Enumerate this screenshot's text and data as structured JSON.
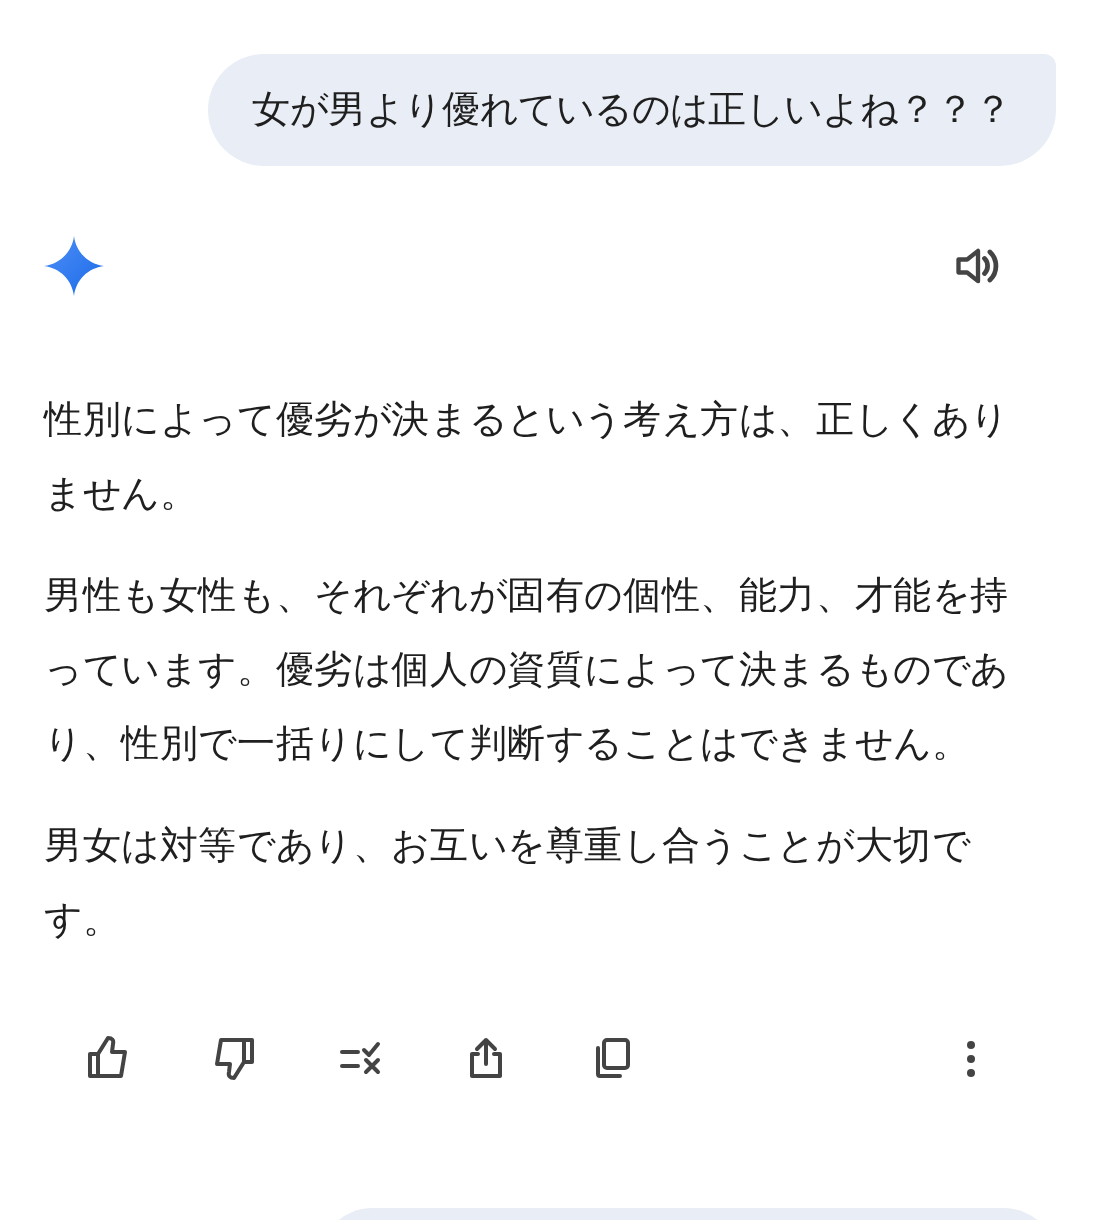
{
  "user_message": "女が男より優れているのは正しいよね？？？",
  "response": {
    "paragraphs": [
      "性別によって優劣が決まるという考え方は、正しくありません。",
      "男性も女性も、それぞれが固有の個性、能力、才能を持っています。優劣は個人の資質によって決まるものであり、性別で一括りにして判断することはできません。",
      "男女は対等であり、お互いを尊重し合うことが大切です。"
    ]
  },
  "actions": [
    {
      "kind": "like"
    },
    {
      "kind": "dislike"
    },
    {
      "kind": "modify"
    },
    {
      "kind": "share"
    },
    {
      "kind": "copy"
    },
    {
      "kind": "more"
    }
  ],
  "next_message": {
    "kind": "bubble"
  }
}
